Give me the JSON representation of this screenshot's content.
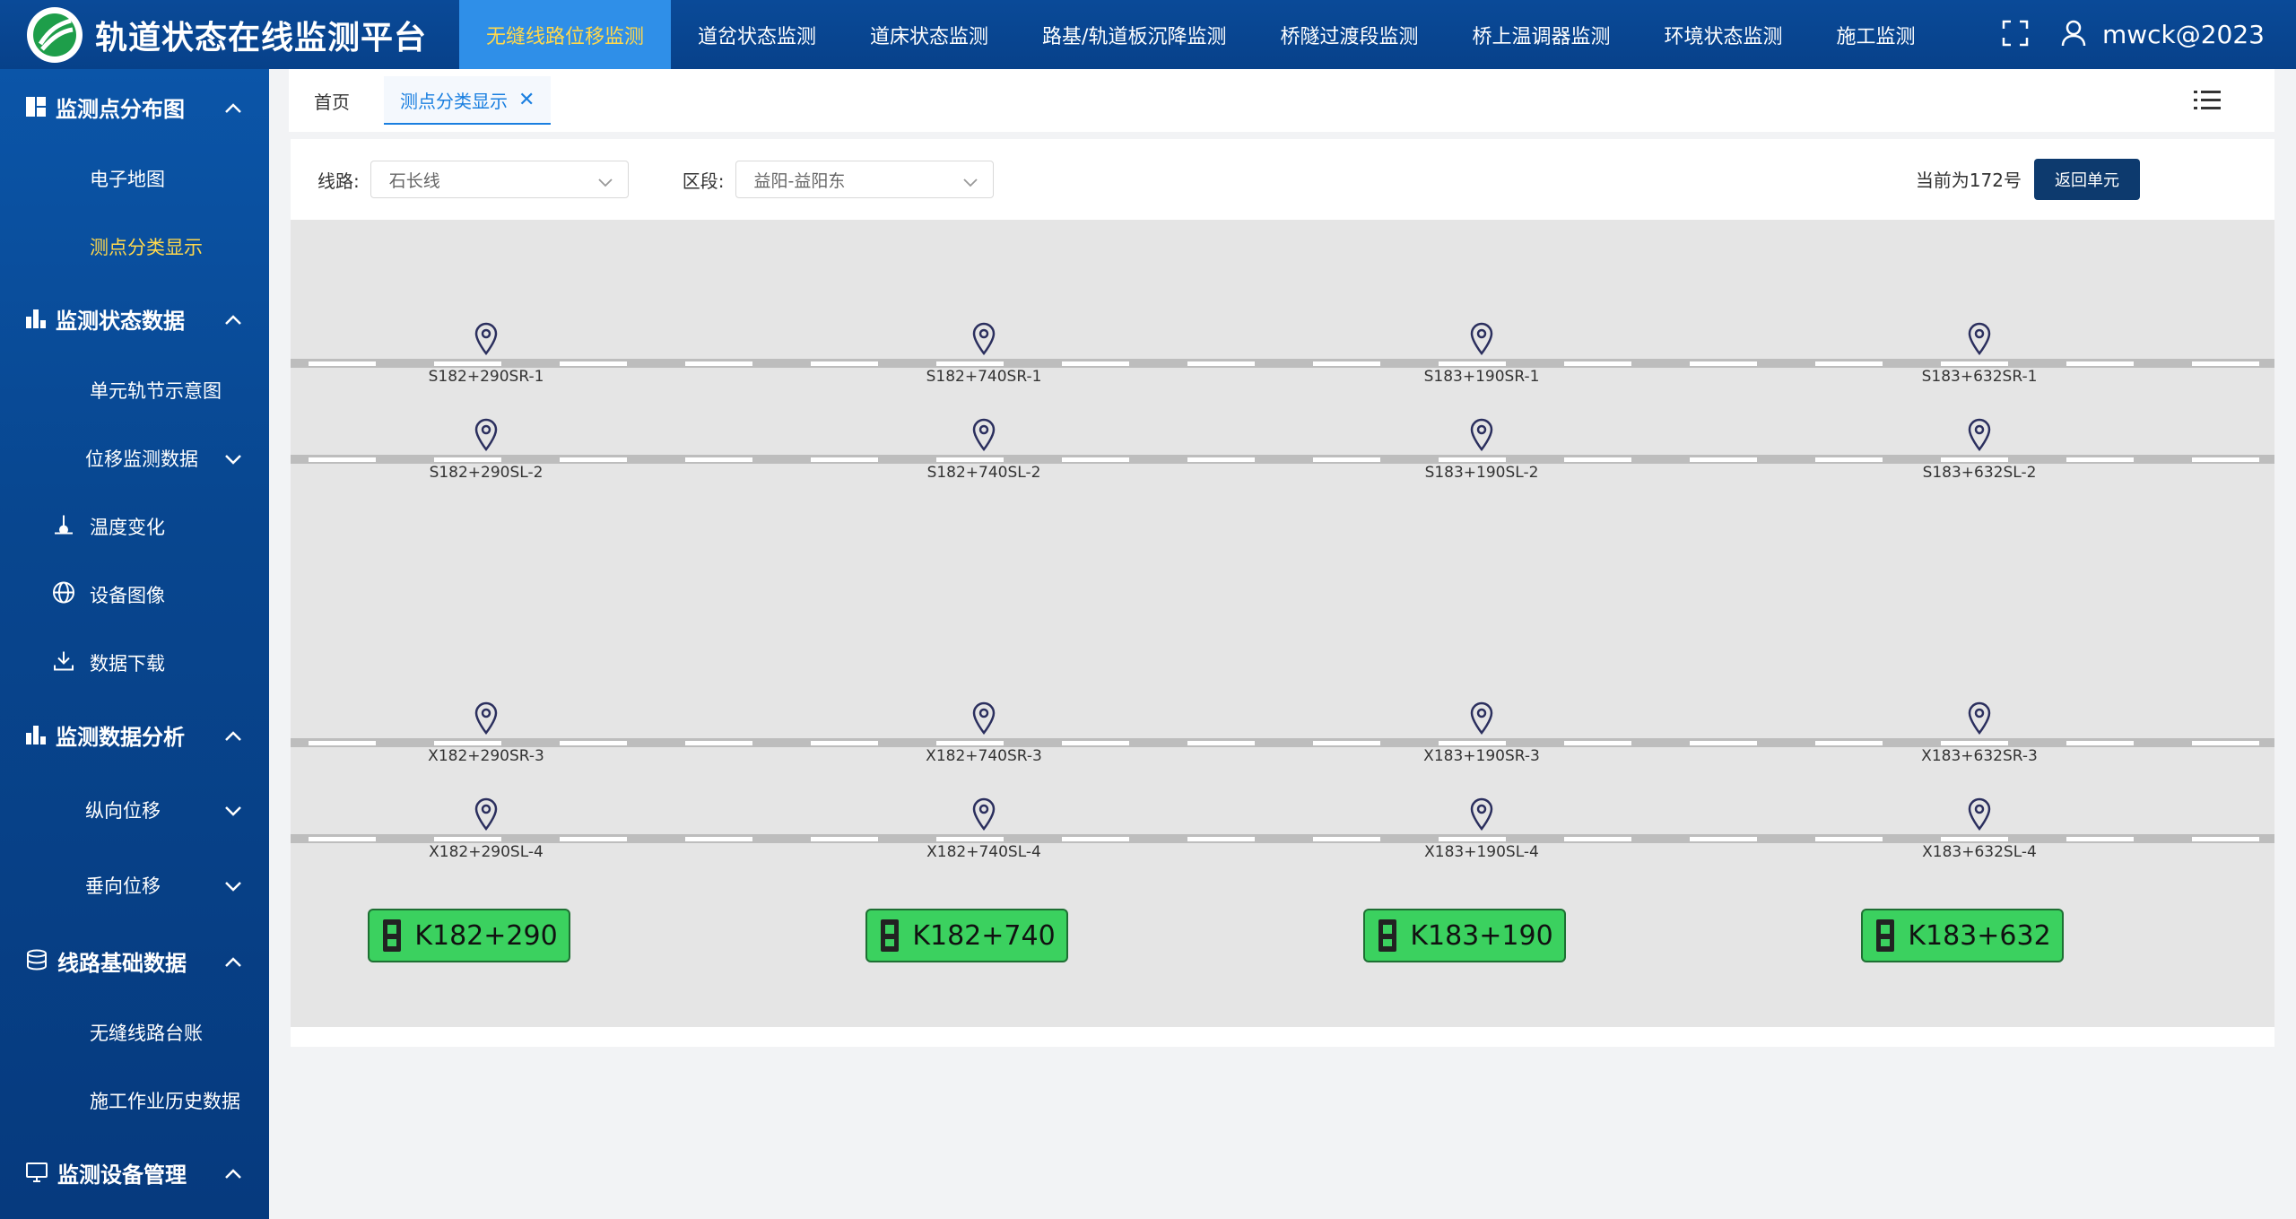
{
  "header": {
    "title": "轨道状态在线监测平台",
    "nav": [
      "无缝线路位移监测",
      "道岔状态监测",
      "道床状态监测",
      "路基/轨道板沉降监测",
      "桥隧过渡段监测",
      "桥上温调器监测",
      "环境状态监测",
      "施工监测"
    ],
    "user": "mwck@2023"
  },
  "sidebar": {
    "groups": [
      {
        "label": "监测点分布图",
        "items": [
          {
            "label": "电子地图"
          },
          {
            "label": "测点分类显示"
          }
        ]
      },
      {
        "label": "监测状态数据",
        "items": [
          {
            "label": "单元轨节示意图"
          },
          {
            "label": "位移监测数据"
          },
          {
            "label": "温度变化"
          },
          {
            "label": "设备图像"
          },
          {
            "label": "数据下载"
          }
        ]
      },
      {
        "label": "监测数据分析",
        "items": [
          {
            "label": "纵向位移"
          },
          {
            "label": "垂向位移"
          }
        ]
      },
      {
        "label": "线路基础数据",
        "items": [
          {
            "label": "无缝线路台账"
          },
          {
            "label": "施工作业历史数据"
          }
        ]
      },
      {
        "label": "监测设备管理",
        "items": []
      }
    ]
  },
  "tabs": {
    "home": "首页",
    "active": "测点分类显示"
  },
  "filters": {
    "line_label": "线路:",
    "line_value": "石长线",
    "section_label": "区段:",
    "section_value": "益阳-益阳东",
    "current": "当前为172号",
    "back": "返回单元"
  },
  "tracks": [
    {
      "points": [
        "S182+290SR-1",
        "S182+740SR-1",
        "S183+190SR-1",
        "S183+632SR-1"
      ]
    },
    {
      "points": [
        "S182+290SL-2",
        "S182+740SL-2",
        "S183+190SL-2",
        "S183+632SL-2"
      ]
    },
    {
      "points": [
        "X182+290SR-3",
        "X182+740SR-3",
        "X183+190SR-3",
        "X183+632SR-3"
      ]
    },
    {
      "points": [
        "X182+290SL-4",
        "X182+740SL-4",
        "X183+190SL-4",
        "X183+632SL-4"
      ]
    }
  ],
  "stations": [
    "K182+290",
    "K182+740",
    "K183+190",
    "K183+632"
  ],
  "colors": {
    "header": "#0a4a98",
    "active_nav": "#2f8fe8",
    "highlight": "#ffd84d",
    "station": "#3bd15f",
    "button": "#0d3a6e"
  }
}
